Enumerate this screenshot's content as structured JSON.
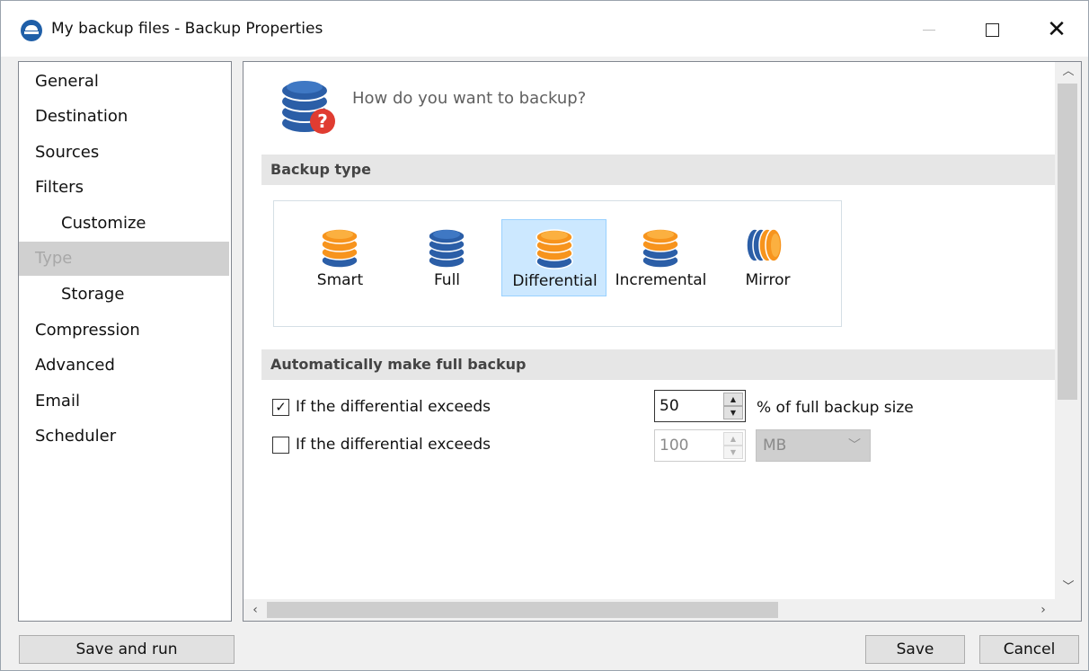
{
  "window": {
    "title": "My backup files - Backup Properties",
    "icon": "app-logo-icon",
    "controls": [
      "minimize-icon",
      "maximize-icon",
      "close-icon"
    ]
  },
  "nav": {
    "items": [
      {
        "label": "General",
        "sub": false,
        "selected": false
      },
      {
        "label": "Destination",
        "sub": false,
        "selected": false
      },
      {
        "label": "Sources",
        "sub": false,
        "selected": false
      },
      {
        "label": "Filters",
        "sub": false,
        "selected": false
      },
      {
        "label": "Customize",
        "sub": true,
        "selected": false
      },
      {
        "label": "Type",
        "sub": false,
        "selected": true
      },
      {
        "label": "Storage",
        "sub": true,
        "selected": false
      },
      {
        "label": "Compression",
        "sub": false,
        "selected": false
      },
      {
        "label": "Advanced",
        "sub": false,
        "selected": false
      },
      {
        "label": "Email",
        "sub": false,
        "selected": false
      },
      {
        "label": "Scheduler",
        "sub": false,
        "selected": false
      }
    ]
  },
  "main": {
    "question": "How do you want to backup?",
    "backup_type": {
      "heading": "Backup type",
      "options": [
        {
          "label": "Smart",
          "icon": "smart-backup-icon",
          "selected": false
        },
        {
          "label": "Full",
          "icon": "full-backup-icon",
          "selected": false
        },
        {
          "label": "Differential",
          "icon": "differential-backup-icon",
          "selected": true
        },
        {
          "label": "Incremental",
          "icon": "incremental-backup-icon",
          "selected": false
        },
        {
          "label": "Mirror",
          "icon": "mirror-backup-icon",
          "selected": false
        }
      ]
    },
    "auto_full": {
      "heading": "Automatically make full backup",
      "rows": [
        {
          "label": "If the differential exceeds",
          "checked": true,
          "value": "50",
          "unit": "% of full backup size",
          "enabled": true
        },
        {
          "label": "If the differential exceeds",
          "checked": false,
          "value": "100",
          "unit": "MB",
          "enabled": false
        }
      ]
    }
  },
  "buttons": {
    "save_and_run": "Save and run",
    "save": "Save",
    "cancel": "Cancel"
  },
  "colors": {
    "accent_blue": "#2b5ea7",
    "accent_orange": "#f7941d",
    "selection": "#cce8ff",
    "badge_red": "#e03c31"
  }
}
